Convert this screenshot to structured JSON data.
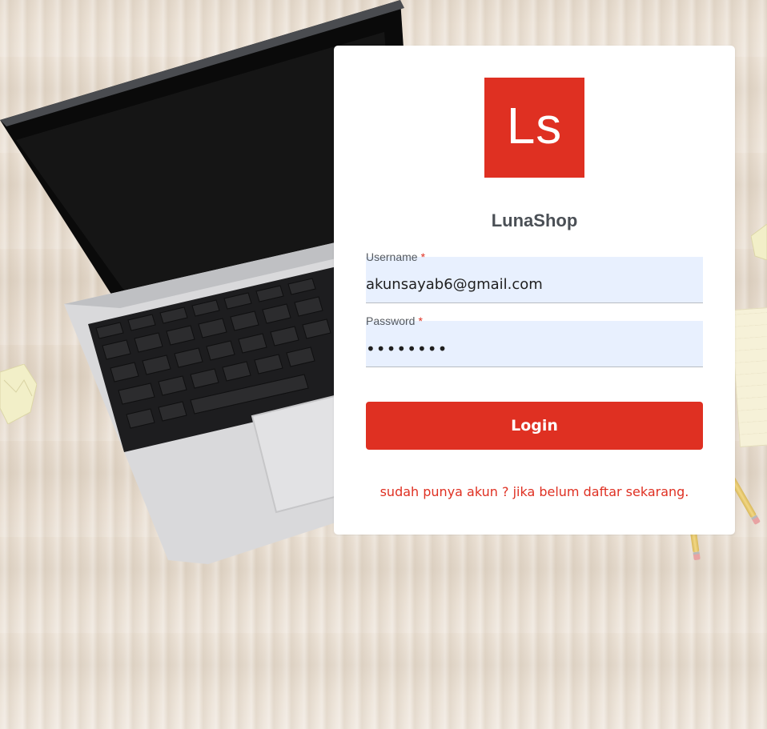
{
  "brand": {
    "logo_text": "Ls",
    "name": "LunaShop",
    "accent_color": "#df3022"
  },
  "form": {
    "username": {
      "label": "Username",
      "required_mark": "*",
      "value": "akunsayab6@gmail.com"
    },
    "password": {
      "label": "Password",
      "required_mark": "*",
      "value": "••••••••"
    },
    "login_label": "Login",
    "signup_link": "sudah punya akun ? jika belum daftar sekarang."
  }
}
